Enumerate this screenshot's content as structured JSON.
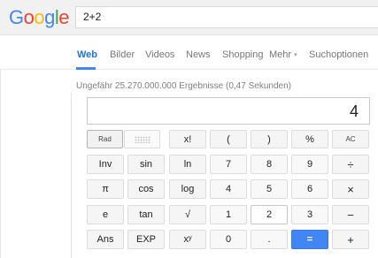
{
  "header": {
    "logo_letters": [
      {
        "char": "G",
        "color": "#4285f4"
      },
      {
        "char": "o",
        "color": "#ea4335"
      },
      {
        "char": "o",
        "color": "#fbbc05"
      },
      {
        "char": "g",
        "color": "#4285f4"
      },
      {
        "char": "l",
        "color": "#34a853"
      },
      {
        "char": "e",
        "color": "#ea4335"
      }
    ],
    "query": "2+2"
  },
  "tabs": {
    "web": "Web",
    "images": "Bilder",
    "videos": "Videos",
    "news": "News",
    "shopping": "Shopping",
    "more": "Mehr",
    "more_caret": "▾",
    "search_tools": "Suchoptionen",
    "active": "Web"
  },
  "results": {
    "stats": "Ungefähr 25.270.000.000 Ergebnisse (0,47 Sekunden)"
  },
  "calculator": {
    "display": "4",
    "keys": {
      "rad": "Rad",
      "fact": "x!",
      "lparen": "(",
      "rparen": ")",
      "percent": "%",
      "ac": "AC",
      "inv": "Inv",
      "sin": "sin",
      "ln": "ln",
      "n7": "7",
      "n8": "8",
      "n9": "9",
      "divide": "÷",
      "pi": "π",
      "cos": "cos",
      "log": "log",
      "n4": "4",
      "n5": "5",
      "n6": "6",
      "multiply": "×",
      "e": "e",
      "tan": "tan",
      "sqrt": "√",
      "n1": "1",
      "n2": "2",
      "n3": "3",
      "minus": "−",
      "ans": "Ans",
      "exp": "EXP",
      "power": "xʸ",
      "n0": "0",
      "dot": ".",
      "equals": "=",
      "plus": "+"
    }
  },
  "colors": {
    "accent": "#4285f4",
    "tab_active": "#1a73e8"
  }
}
